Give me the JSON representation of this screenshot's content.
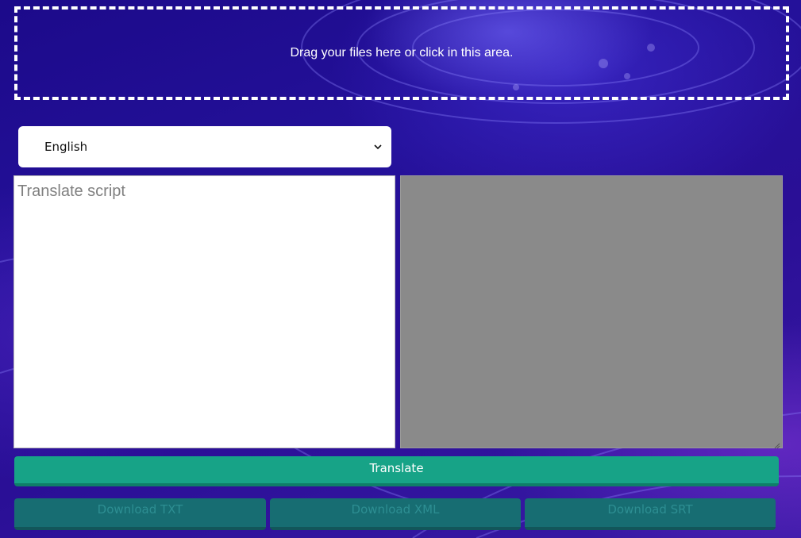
{
  "upload": {
    "dropzone_text": "Drag your files here or click in this area."
  },
  "language_select": {
    "selected": "English",
    "icon": "chevron-down-icon"
  },
  "editor": {
    "source_placeholder": "Translate script",
    "source_value": ""
  },
  "actions": {
    "translate_label": "Translate",
    "download_txt_label": "Download TXT",
    "download_xml_label": "Download XML",
    "download_srt_label": "Download SRT"
  },
  "colors": {
    "background": "#24119a",
    "translate_button": "#17a387",
    "download_button": "#176d72",
    "output_panel": "#8a8a8a"
  }
}
